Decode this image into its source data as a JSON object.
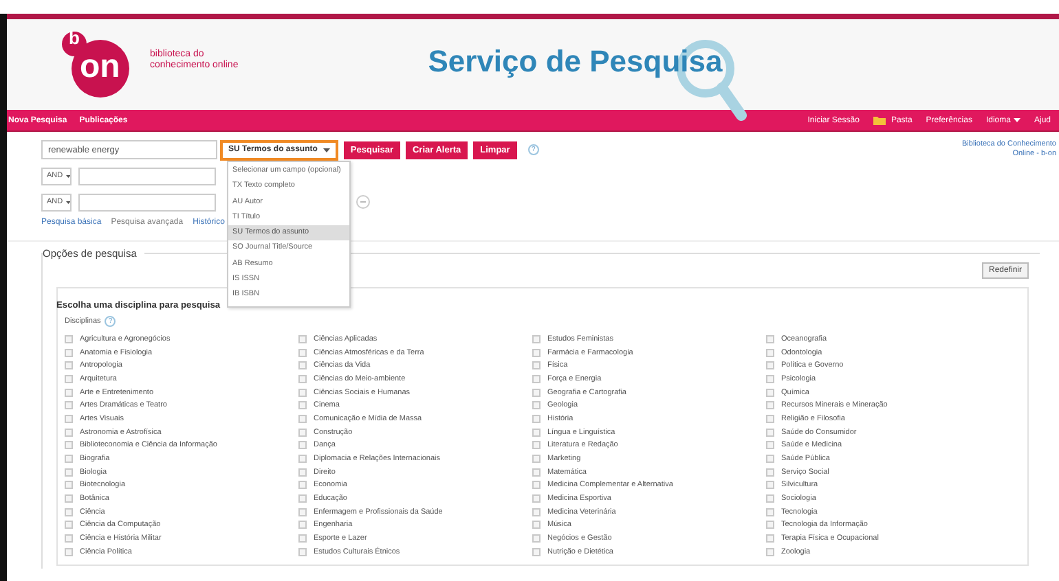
{
  "logo": {
    "letter_top": "b",
    "letters": "on",
    "tagline": [
      "biblioteca do",
      "conhecimento online"
    ]
  },
  "title": "Serviço de Pesquisa",
  "nav": {
    "left": [
      "Nova Pesquisa",
      "Publicações"
    ],
    "right": [
      {
        "label": "Iniciar Sessão",
        "kind": "link"
      },
      {
        "label": "Pasta",
        "kind": "folder"
      },
      {
        "label": "Preferências",
        "kind": "link"
      },
      {
        "label": "Idioma",
        "kind": "menu"
      },
      {
        "label": "Ajud",
        "kind": "link"
      }
    ]
  },
  "institution": [
    "Biblioteca do Conhecimento",
    "Online - b-on"
  ],
  "search": {
    "query": "renewable energy",
    "field": "SU Termos do assunto",
    "buttons": [
      "Pesquisar",
      "Criar Alerta",
      "Limpar"
    ],
    "help": "?",
    "rows": [
      {
        "operator": "AND"
      },
      {
        "operator": "AND"
      }
    ],
    "field_menu": [
      {
        "label": "Selecionar um campo (opcional)",
        "selected": false
      },
      {
        "label": "TX Texto completo",
        "selected": false
      },
      {
        "label": "AU Autor",
        "selected": false
      },
      {
        "label": "TI Título",
        "selected": false
      },
      {
        "label": "SU Termos do assunto",
        "selected": true
      },
      {
        "label": "SO Journal Title/Source",
        "selected": false
      },
      {
        "label": "AB Resumo",
        "selected": false
      },
      {
        "label": "IS ISSN",
        "selected": false
      },
      {
        "label": "IB ISBN",
        "selected": false
      }
    ],
    "links": [
      {
        "label": "Pesquisa básica",
        "selected": false
      },
      {
        "label": "Pesquisa avançada",
        "selected": true
      },
      {
        "label": "Histórico",
        "selected": false
      }
    ]
  },
  "options": {
    "title": "Opções de pesquisa",
    "reset": "Redefinir",
    "heading": "Escolha uma disciplina para pesquisa",
    "disciplines_label": "Disciplinas",
    "help": "?",
    "disciplines": [
      {
        "label": "Agricultura e Agronegócios",
        "checked": false
      },
      {
        "label": "Anatomia e Fisiologia",
        "checked": false
      },
      {
        "label": "Antropologia",
        "checked": false
      },
      {
        "label": "Arquitetura",
        "checked": false
      },
      {
        "label": "Arte e Entretenimento",
        "checked": false
      },
      {
        "label": "Artes Dramáticas e Teatro",
        "checked": false
      },
      {
        "label": "Artes Visuais",
        "checked": false
      },
      {
        "label": "Astronomia e Astrofísica",
        "checked": false
      },
      {
        "label": "Biblioteconomia e Ciência da Informação",
        "checked": false
      },
      {
        "label": "Biografia",
        "checked": false
      },
      {
        "label": "Biologia",
        "checked": false
      },
      {
        "label": "Biotecnologia",
        "checked": false
      },
      {
        "label": "Botânica",
        "checked": false
      },
      {
        "label": "Ciência",
        "checked": false
      },
      {
        "label": "Ciência da Computação",
        "checked": false
      },
      {
        "label": "Ciência e História Militar",
        "checked": false
      },
      {
        "label": "Ciência Política",
        "checked": false
      },
      {
        "label": "Ciências Aplicadas",
        "checked": false
      },
      {
        "label": "Ciências Atmosféricas e da Terra",
        "checked": false
      },
      {
        "label": "Ciências da Vida",
        "checked": false
      },
      {
        "label": "Ciências do Meio-ambiente",
        "checked": false
      },
      {
        "label": "Ciências Sociais e Humanas",
        "checked": false
      },
      {
        "label": "Cinema",
        "checked": false
      },
      {
        "label": "Comunicação e Mídia de Massa",
        "checked": false
      },
      {
        "label": "Construção",
        "checked": false
      },
      {
        "label": "Dança",
        "checked": false
      },
      {
        "label": "Diplomacia e Relações Internacionais",
        "checked": false
      },
      {
        "label": "Direito",
        "checked": false
      },
      {
        "label": "Economia",
        "checked": false
      },
      {
        "label": "Educação",
        "checked": false
      },
      {
        "label": "Enfermagem e Profissionais da Saúde",
        "checked": false
      },
      {
        "label": "Engenharia",
        "checked": false
      },
      {
        "label": "Esporte e Lazer",
        "checked": false
      },
      {
        "label": "Estudos Culturais Étnicos",
        "checked": false
      },
      {
        "label": "Estudos Feministas",
        "checked": false
      },
      {
        "label": "Farmácia e Farmacologia",
        "checked": false
      },
      {
        "label": "Física",
        "checked": false
      },
      {
        "label": "Força e Energia",
        "checked": false
      },
      {
        "label": "Geografia e Cartografia",
        "checked": false
      },
      {
        "label": "Geologia",
        "checked": false
      },
      {
        "label": "História",
        "checked": false
      },
      {
        "label": "Língua e Linguística",
        "checked": false
      },
      {
        "label": "Literatura e Redação",
        "checked": false
      },
      {
        "label": "Marketing",
        "checked": false
      },
      {
        "label": "Matemática",
        "checked": false
      },
      {
        "label": "Medicina Complementar e Alternativa",
        "checked": false
      },
      {
        "label": "Medicina Esportiva",
        "checked": false
      },
      {
        "label": "Medicina Veterinária",
        "checked": false
      },
      {
        "label": "Música",
        "checked": false
      },
      {
        "label": "Negócios e Gestão",
        "checked": false
      },
      {
        "label": "Nutrição e Dietética",
        "checked": false
      },
      {
        "label": "Oceanografia",
        "checked": false
      },
      {
        "label": "Odontologia",
        "checked": false
      },
      {
        "label": "Política e Governo",
        "checked": false
      },
      {
        "label": "Psicologia",
        "checked": false
      },
      {
        "label": "Química",
        "checked": false
      },
      {
        "label": "Recursos Minerais e Mineração",
        "checked": false
      },
      {
        "label": "Religião e Filosofia",
        "checked": false
      },
      {
        "label": "Saúde do Consumidor",
        "checked": false
      },
      {
        "label": "Saúde e Medicina",
        "checked": false
      },
      {
        "label": "Saúde Pública",
        "checked": false
      },
      {
        "label": "Serviço Social",
        "checked": false
      },
      {
        "label": "Silvicultura",
        "checked": false
      },
      {
        "label": "Sociologia",
        "checked": false
      },
      {
        "label": "Tecnologia",
        "checked": false
      },
      {
        "label": "Tecnologia da Informação",
        "checked": false
      },
      {
        "label": "Terapia Física e Ocupacional",
        "checked": false
      },
      {
        "label": "Zoologia",
        "checked": false
      }
    ]
  }
}
